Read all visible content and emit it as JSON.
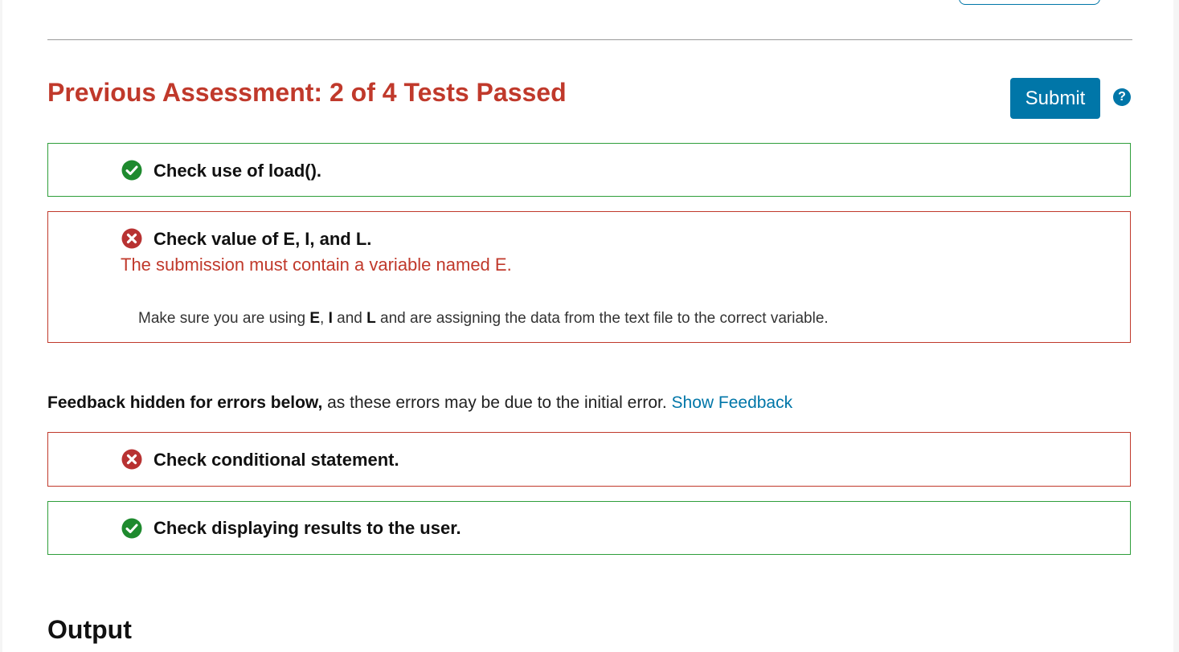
{
  "assessment": {
    "title": "Previous Assessment: 2 of 4 Tests Passed",
    "submit_label": "Submit",
    "help_symbol": "?"
  },
  "tests": [
    {
      "status": "pass",
      "icon": "check-circle-icon",
      "title": "Check use of load()."
    },
    {
      "status": "fail",
      "icon": "x-circle-icon",
      "title": "Check value of E, I, and L.",
      "error_message": "The submission must contain a variable named E.",
      "hint": {
        "part1": "Make sure you are using ",
        "var1": "E",
        "sep1": ", ",
        "var2": "I",
        "sep2": " and ",
        "var3": "L",
        "part2": " and are assigning the data from the text file to the correct variable."
      }
    },
    {
      "status": "fail",
      "icon": "x-circle-icon",
      "title": "Check conditional statement."
    },
    {
      "status": "pass",
      "icon": "check-circle-icon",
      "title": "Check displaying results to the user."
    }
  ],
  "feedback_notice": {
    "bold_text": "Feedback hidden for errors below,",
    "text": " as these errors may be due to the initial error. ",
    "link_label": "Show Feedback"
  },
  "output": {
    "heading": "Output"
  },
  "colors": {
    "pass": "#2e9e3a",
    "fail": "#c0392b",
    "accent": "#0076a8"
  }
}
